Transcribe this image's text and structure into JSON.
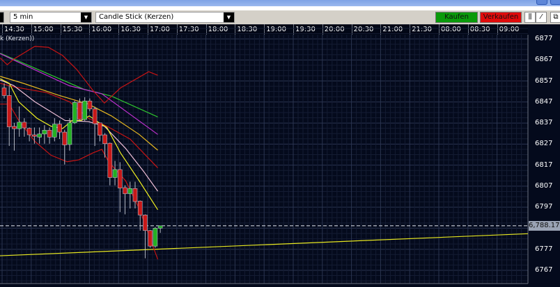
{
  "toolbar": {
    "interval": "5 min",
    "chart_type": "Candle Stick (Kerzen)",
    "buy": "Kaufen",
    "sell": "Verkaufen",
    "buy_color": "#0a9a0a",
    "sell_color": "#e00b0b"
  },
  "legend": "k (Kerzen))",
  "chart_data": {
    "type": "candlestick",
    "time_labels": [
      "14:30",
      "15:00",
      "15:30",
      "16:00",
      "16:30",
      "17:00",
      "17:30",
      "18:00",
      "18:30",
      "19:00",
      "19:30",
      "20:00",
      "20:30",
      "21:00",
      "21:30",
      "08:00",
      "08:30",
      "09:00"
    ],
    "price_labels": [
      "6877",
      "6867",
      "6857",
      "6847",
      "6837",
      "6827",
      "6817",
      "6807",
      "6797",
      "6777",
      "6767"
    ],
    "ylim": [
      6767,
      6877
    ],
    "last_price": "6,788.17",
    "last_price_value": 6788.17,
    "candles": [
      [
        6853.7,
        6855.9,
        6848.7,
        6850.1
      ],
      [
        6850.1,
        6854.8,
        6826.1,
        6835.2
      ],
      [
        6835.4,
        6837.1,
        6823.9,
        6834.3
      ],
      [
        6834.3,
        6844.9,
        6830.5,
        6837.4
      ],
      [
        6837.4,
        6839.3,
        6830.5,
        6834.7
      ],
      [
        6834.5,
        6834.9,
        6828.3,
        6831.4
      ],
      [
        6831.4,
        6834.9,
        6827.2,
        6830.7
      ],
      [
        6830.3,
        6834.9,
        6827.2,
        6831.8
      ],
      [
        6831.8,
        6836.0,
        6827.2,
        6833.6
      ],
      [
        6833.6,
        6834.9,
        6827.2,
        6830.3
      ],
      [
        6830.3,
        6839.3,
        6828.3,
        6836.5
      ],
      [
        6836.5,
        6838.2,
        6829.4,
        6832.7
      ],
      [
        6832.7,
        6833.8,
        6817.3,
        6826.6
      ],
      [
        6826.8,
        6839.3,
        6823.9,
        6837.1
      ],
      [
        6837.1,
        6847.6,
        6836.6,
        6846.8
      ],
      [
        6846.8,
        6848.7,
        6838.2,
        6838.7
      ],
      [
        6838.7,
        6849.3,
        6837.7,
        6847.5
      ],
      [
        6847.5,
        6848.7,
        6842.6,
        6843.7
      ],
      [
        6843.7,
        6844.8,
        6826.1,
        6836.7
      ],
      [
        6837.1,
        6837.1,
        6828.3,
        6831.2
      ],
      [
        6831.4,
        6832.2,
        6820.6,
        6827.2
      ],
      [
        6827.4,
        6827.7,
        6807.4,
        6811.1
      ],
      [
        6811.1,
        6819.0,
        6807.4,
        6814.9
      ],
      [
        6814.9,
        6818.4,
        6794.7,
        6806.1
      ],
      [
        6806.3,
        6807.4,
        6793.6,
        6803.4
      ],
      [
        6803.4,
        6809.1,
        6796.4,
        6805.9
      ],
      [
        6805.9,
        6809.1,
        6796.4,
        6799.7
      ],
      [
        6799.9,
        6800.2,
        6785.9,
        6793.3
      ],
      [
        6793.3,
        6793.6,
        6772.7,
        6785.9
      ],
      [
        6785.9,
        6786.2,
        6777.7,
        6778.5
      ],
      [
        6778.5,
        6787.6,
        6777.7,
        6787.0
      ],
      [
        6787.0,
        6788.2,
        6784.8,
        6788.17
      ]
    ],
    "indicators": [
      {
        "name": "ma-green",
        "color": "#2fc42f",
        "points": [
          [
            -0.8,
            6870.2
          ],
          [
            15.8,
            6853.1
          ],
          [
            21.3,
            6849.8
          ],
          [
            30.5,
            6839.9
          ]
        ]
      },
      {
        "name": "ma-magenta",
        "color": "#c030d0",
        "points": [
          [
            -0.8,
            6870.0
          ],
          [
            1.5,
            6867.4
          ],
          [
            13,
            6854.7
          ],
          [
            19.4,
            6850.9
          ],
          [
            30.5,
            6831.6
          ]
        ]
      },
      {
        "name": "bollinger-upper",
        "color": "#c81414",
        "points": [
          [
            -0.8,
            6868
          ],
          [
            0.6,
            6864.7
          ],
          [
            1.9,
            6867.4
          ],
          [
            6.1,
            6873.5
          ],
          [
            8.8,
            6873
          ],
          [
            11.6,
            6869.1
          ],
          [
            14.4,
            6862.5
          ],
          [
            17.6,
            6852.6
          ],
          [
            19.9,
            6846.5
          ],
          [
            23.1,
            6853.7
          ],
          [
            28.7,
            6861.4
          ],
          [
            30.5,
            6859.7
          ]
        ]
      },
      {
        "name": "bollinger-middle",
        "color": "#c81414",
        "points": [
          [
            -0.8,
            6855.9
          ],
          [
            1.9,
            6854.2
          ],
          [
            8.4,
            6851.5
          ],
          [
            13,
            6847.1
          ],
          [
            16.7,
            6839.3
          ],
          [
            20.4,
            6835.5
          ],
          [
            25,
            6829.4
          ],
          [
            30.5,
            6815.7
          ]
        ]
      },
      {
        "name": "bollinger-lower",
        "color": "#c81414",
        "points": [
          [
            -0.8,
            6846
          ],
          [
            1,
            6846
          ],
          [
            2.9,
            6838.2
          ],
          [
            6.1,
            6828.3
          ],
          [
            9.3,
            6821.7
          ],
          [
            12.5,
            6818.6
          ],
          [
            14.8,
            6819.5
          ],
          [
            17.6,
            6822.8
          ],
          [
            19.4,
            6824.5
          ],
          [
            20.8,
            6818.4
          ],
          [
            24.1,
            6809.6
          ],
          [
            26.8,
            6796.4
          ],
          [
            30.5,
            6772.2
          ]
        ]
      },
      {
        "name": "ma-gold",
        "color": "#e8b820",
        "points": [
          [
            -0.8,
            6859.2
          ],
          [
            3.8,
            6855.9
          ],
          [
            10.7,
            6850.3
          ],
          [
            16.7,
            6846
          ],
          [
            21.3,
            6840.4
          ],
          [
            26.8,
            6831.6
          ],
          [
            30.5,
            6824.1
          ]
        ]
      },
      {
        "name": "ma-pink",
        "color": "#f0c0d8",
        "points": [
          [
            -0.8,
            6857.5
          ],
          [
            1.9,
            6854.8
          ],
          [
            6.1,
            6847.1
          ],
          [
            12.1,
            6838.2
          ],
          [
            16.7,
            6837.7
          ],
          [
            19.9,
            6835.5
          ],
          [
            24.1,
            6825
          ],
          [
            27.7,
            6814
          ],
          [
            30.5,
            6804.6
          ]
        ]
      },
      {
        "name": "ma-yellow",
        "color": "#f0f020",
        "points": [
          [
            -0.8,
            6858.1
          ],
          [
            1,
            6855.9
          ],
          [
            2.9,
            6847.1
          ],
          [
            6.5,
            6839.3
          ],
          [
            9.3,
            6835.5
          ],
          [
            11.6,
            6834.4
          ],
          [
            13.5,
            6838.2
          ],
          [
            15.3,
            6838.2
          ],
          [
            16.9,
            6840.4
          ],
          [
            18.5,
            6837.7
          ],
          [
            20.4,
            6834.9
          ],
          [
            23.1,
            6822.8
          ],
          [
            26.8,
            6809.6
          ],
          [
            30.5,
            6795.8
          ]
        ]
      }
    ],
    "support_line": {
      "color": "#e8e820",
      "start_price": 6773.9,
      "end_price": 6784.4
    }
  }
}
